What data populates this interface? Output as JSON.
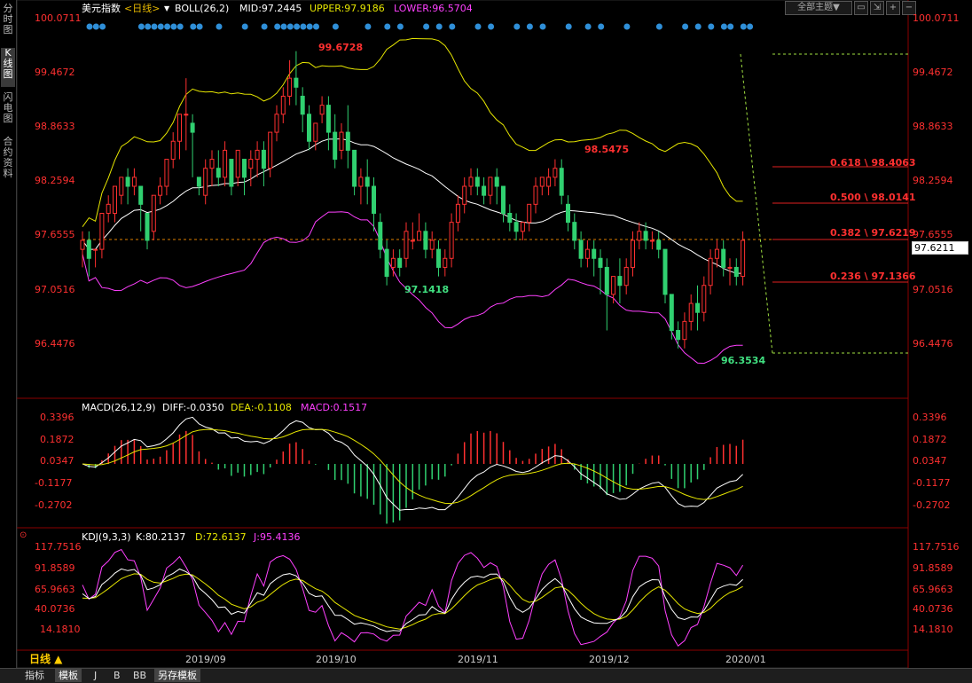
{
  "sidebar": {
    "tabs": [
      "分时图",
      "K线图",
      "闪电图",
      "合约资料"
    ],
    "active": 1
  },
  "header": {
    "name": "美元指数",
    "period": "<日线>",
    "boll": "BOLL(26,2)",
    "mid": "MID:97.2445",
    "upper": "UPPER:97.9186",
    "lower": "LOWER:96.5704",
    "theme_button": "全部主题▼",
    "colors": {
      "name": "#ffffff",
      "period": "#e6b800",
      "mid": "#ffffff",
      "upper": "#e6e600",
      "lower": "#ff40ff"
    }
  },
  "price_axis": {
    "ticks": [
      "100.0711",
      "99.4672",
      "98.8633",
      "98.2594",
      "97.6555",
      "97.0516",
      "96.4476"
    ],
    "current_price": "97.6211"
  },
  "annotations": {
    "high": "99.6728",
    "high2": "98.5475",
    "low": "97.1418",
    "low2": "96.3534"
  },
  "fibonacci": [
    {
      "label": "0.618 \\ 98.4063"
    },
    {
      "label": "0.500 \\ 98.0141"
    },
    {
      "label": "0.382 \\ 97.6219"
    },
    {
      "label": "0.236 \\ 97.1366"
    }
  ],
  "macd": {
    "title": "MACD(26,12,9)",
    "diff": "DIFF:-0.0350",
    "dea": "DEA:-0.1108",
    "macd": "MACD:0.1517",
    "ticks": [
      "0.3396",
      "0.1872",
      "0.0347",
      "-0.1177",
      "-0.2702"
    ]
  },
  "kdj": {
    "title": "KDJ(9,3,3)",
    "k": "K:80.2137",
    "d": "D:72.6137",
    "j": "J:95.4136",
    "ticks": [
      "117.7516",
      "91.8589",
      "65.9663",
      "40.0736",
      "14.1810"
    ]
  },
  "time_axis": {
    "period_button": "日线 ▲",
    "dates": [
      "2019/09",
      "2019/10",
      "2019/11",
      "2019/12",
      "2020/01"
    ]
  },
  "bottom_tabs": [
    "指标",
    "模板",
    "J",
    "B",
    "BB",
    "另存模板"
  ],
  "chart_data": {
    "type": "candlestick",
    "title": "美元指数 <日线>",
    "ylim": [
      96.2,
      100.2
    ],
    "candles": [
      [
        97.5,
        97.7,
        97.6,
        97.3
      ],
      [
        97.6,
        97.7,
        97.4,
        97.2
      ],
      [
        97.5,
        97.5,
        97.5,
        97.3
      ],
      [
        97.5,
        97.9,
        97.9,
        97.4
      ],
      [
        97.9,
        98.1,
        98.0,
        97.8
      ],
      [
        97.9,
        98.2,
        98.2,
        97.8
      ],
      [
        98.1,
        98.3,
        98.3,
        98.0
      ],
      [
        98.3,
        98.4,
        98.2,
        98.0
      ],
      [
        98.2,
        98.4,
        98.3,
        98.1
      ],
      [
        98.2,
        98.2,
        98.0,
        97.7
      ],
      [
        97.9,
        97.9,
        97.6,
        97.5
      ],
      [
        97.7,
        98.1,
        98.1,
        97.6
      ],
      [
        98.1,
        98.3,
        98.2,
        98.0
      ],
      [
        98.2,
        98.5,
        98.5,
        98.1
      ],
      [
        98.5,
        98.8,
        98.7,
        98.4
      ],
      [
        98.7,
        99.0,
        99.0,
        98.5
      ],
      [
        99.0,
        99.4,
        99.0,
        98.6
      ],
      [
        98.9,
        99.0,
        98.8,
        98.3
      ],
      [
        98.3,
        98.3,
        98.2,
        98.1
      ],
      [
        98.1,
        98.5,
        98.4,
        98.0
      ],
      [
        98.4,
        98.6,
        98.5,
        98.2
      ],
      [
        98.4,
        98.6,
        98.3,
        98.2
      ],
      [
        98.3,
        98.7,
        98.6,
        98.2
      ],
      [
        98.5,
        98.5,
        98.2,
        98.1
      ],
      [
        98.3,
        98.6,
        98.6,
        98.2
      ],
      [
        98.5,
        98.5,
        98.3,
        98.1
      ],
      [
        98.4,
        98.6,
        98.5,
        98.2
      ],
      [
        98.5,
        98.7,
        98.6,
        98.3
      ],
      [
        98.6,
        98.7,
        98.4,
        98.2
      ],
      [
        98.4,
        98.8,
        98.8,
        98.3
      ],
      [
        98.8,
        99.1,
        99.0,
        98.7
      ],
      [
        99.0,
        99.3,
        99.2,
        98.9
      ],
      [
        99.2,
        99.6,
        99.4,
        99.1
      ],
      [
        99.4,
        99.7,
        99.3,
        99.1
      ],
      [
        99.2,
        99.3,
        99.0,
        98.8
      ],
      [
        99.0,
        99.1,
        98.7,
        98.6
      ],
      [
        98.7,
        98.9,
        98.9,
        98.6
      ],
      [
        99.0,
        99.2,
        99.1,
        98.9
      ],
      [
        99.1,
        99.2,
        98.8,
        98.6
      ],
      [
        98.8,
        99.0,
        98.5,
        98.4
      ],
      [
        98.6,
        98.9,
        98.8,
        98.5
      ],
      [
        98.8,
        99.1,
        98.6,
        98.4
      ],
      [
        98.6,
        98.6,
        98.2,
        98.1
      ],
      [
        98.2,
        98.4,
        98.3,
        98.0
      ],
      [
        98.3,
        98.5,
        98.2,
        98.0
      ],
      [
        98.2,
        98.3,
        97.9,
        97.7
      ],
      [
        97.8,
        97.9,
        97.5,
        97.4
      ],
      [
        97.5,
        97.6,
        97.2,
        97.1
      ],
      [
        97.3,
        97.5,
        97.4,
        97.2
      ],
      [
        97.4,
        97.5,
        97.3,
        97.2
      ],
      [
        97.4,
        97.8,
        97.7,
        97.3
      ],
      [
        97.6,
        97.8,
        97.6,
        97.5
      ],
      [
        97.6,
        97.9,
        97.7,
        97.6
      ],
      [
        97.7,
        97.8,
        97.5,
        97.4
      ],
      [
        97.5,
        97.7,
        97.6,
        97.4
      ],
      [
        97.5,
        97.6,
        97.3,
        97.2
      ],
      [
        97.3,
        97.5,
        97.4,
        97.2
      ],
      [
        97.4,
        97.9,
        97.8,
        97.3
      ],
      [
        97.8,
        98.1,
        98.0,
        97.7
      ],
      [
        98.0,
        98.3,
        98.2,
        97.9
      ],
      [
        98.2,
        98.4,
        98.3,
        98.1
      ],
      [
        98.3,
        98.4,
        98.2,
        98.1
      ],
      [
        98.2,
        98.3,
        98.1,
        98.0
      ],
      [
        98.1,
        98.3,
        98.3,
        98.0
      ],
      [
        98.3,
        98.4,
        98.2,
        98.0
      ],
      [
        98.2,
        98.2,
        97.9,
        97.8
      ],
      [
        97.9,
        98.0,
        97.8,
        97.7
      ],
      [
        97.8,
        97.9,
        97.7,
        97.6
      ],
      [
        97.7,
        97.8,
        97.8,
        97.6
      ],
      [
        97.8,
        98.0,
        98.0,
        97.7
      ],
      [
        98.0,
        98.3,
        98.2,
        97.9
      ],
      [
        98.2,
        98.3,
        98.3,
        98.1
      ],
      [
        98.2,
        98.4,
        98.3,
        98.1
      ],
      [
        98.3,
        98.5,
        98.4,
        98.2
      ],
      [
        98.4,
        98.5,
        98.1,
        98.0
      ],
      [
        98.0,
        98.1,
        97.8,
        97.7
      ],
      [
        97.8,
        97.9,
        97.6,
        97.5
      ],
      [
        97.6,
        97.7,
        97.4,
        97.3
      ],
      [
        97.4,
        97.6,
        97.5,
        97.3
      ],
      [
        97.5,
        97.6,
        97.4,
        97.2
      ],
      [
        97.4,
        97.5,
        97.3,
        97.0
      ],
      [
        97.3,
        97.4,
        97.0,
        96.6
      ],
      [
        97.0,
        97.2,
        97.2,
        96.9
      ],
      [
        97.2,
        97.4,
        97.1,
        96.9
      ],
      [
        97.1,
        97.4,
        97.3,
        97.0
      ],
      [
        97.3,
        97.7,
        97.6,
        97.2
      ],
      [
        97.6,
        97.8,
        97.7,
        97.5
      ],
      [
        97.7,
        97.8,
        97.6,
        97.5
      ],
      [
        97.6,
        97.7,
        97.6,
        97.5
      ],
      [
        97.6,
        97.7,
        97.5,
        97.4
      ],
      [
        97.5,
        97.5,
        97.0,
        96.9
      ],
      [
        97.0,
        97.0,
        96.6,
        96.5
      ],
      [
        96.6,
        96.7,
        96.5,
        96.4
      ],
      [
        96.5,
        96.8,
        96.7,
        96.4
      ],
      [
        96.7,
        97.0,
        96.9,
        96.6
      ],
      [
        96.9,
        97.1,
        96.8,
        96.6
      ],
      [
        96.8,
        97.2,
        97.1,
        96.7
      ],
      [
        97.1,
        97.5,
        97.4,
        97.0
      ],
      [
        97.4,
        97.6,
        97.5,
        97.3
      ],
      [
        97.5,
        97.6,
        97.3,
        97.2
      ],
      [
        97.3,
        97.4,
        97.3,
        97.1
      ],
      [
        97.3,
        97.4,
        97.2,
        97.1
      ],
      [
        97.2,
        97.7,
        97.6,
        97.1
      ]
    ]
  }
}
